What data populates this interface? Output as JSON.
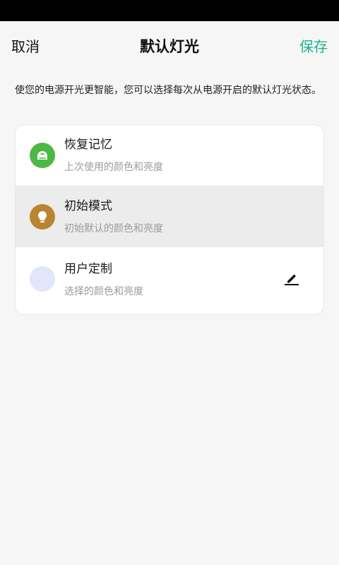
{
  "header": {
    "cancel_label": "取消",
    "title": "默认灯光",
    "save_label": "保存"
  },
  "description": "使您的电源开光更智能，您可以选择每次从电源开启的默认灯光状态。",
  "options": [
    {
      "title": "恢复记忆",
      "subtitle": "上次使用的颜色和亮度",
      "icon": "memory-icon",
      "icon_color": "#4cb944",
      "selected": false
    },
    {
      "title": "初始模式",
      "subtitle": "初始默认的颜色和亮度",
      "icon": "lightbulb-icon",
      "icon_color": "#b98530",
      "selected": true
    },
    {
      "title": "用户定制",
      "subtitle": "选择的颜色和亮度",
      "icon": "custom-color-swatch",
      "icon_color": "#e3e6fa",
      "action_icon": "pencil-icon",
      "selected": false
    }
  ],
  "colors": {
    "accent": "#1bb28f",
    "selected_row_bg": "#ececec",
    "status_bar": "#000000"
  }
}
